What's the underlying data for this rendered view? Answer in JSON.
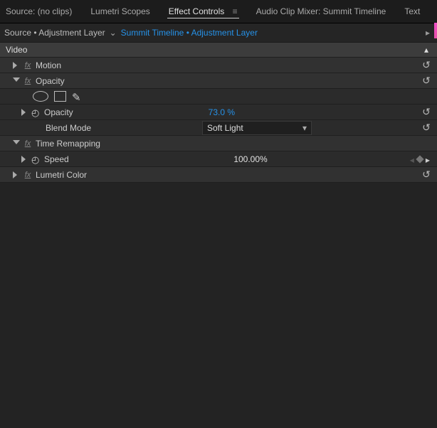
{
  "tabs": {
    "source": "Source: (no clips)",
    "lumetri": "Lumetri Scopes",
    "effect_controls": "Effect Controls",
    "audio_mixer": "Audio Clip Mixer: Summit Timeline",
    "text": "Text"
  },
  "source_bar": {
    "master": "Source • Adjustment Layer",
    "timeline": "Summit Timeline • Adjustment Layer"
  },
  "group_header": "Video",
  "fx_glyph": "fx",
  "motion": {
    "label": "Motion"
  },
  "opacity": {
    "label": "Opacity",
    "prop_label": "Opacity",
    "value": "73.0 %",
    "blend_label": "Blend Mode",
    "blend_value": "Soft Light"
  },
  "time_remapping": {
    "label": "Time Remapping",
    "speed_label": "Speed",
    "speed_value": "100.00%"
  },
  "lumetri_color": {
    "label": "Lumetri Color"
  }
}
